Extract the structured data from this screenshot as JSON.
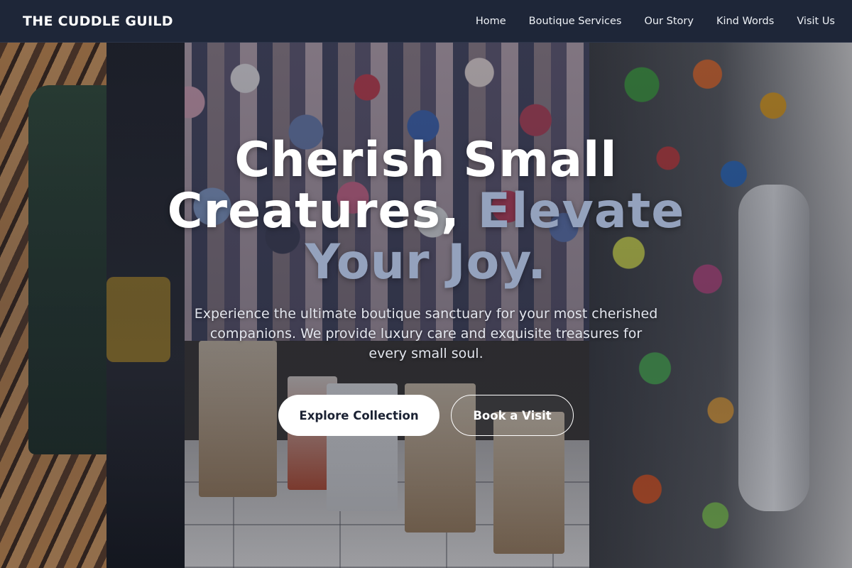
{
  "navbar": {
    "brand": "THE CUDDLE GUILD",
    "links": [
      "Home",
      "Boutique Services",
      "Our Story",
      "Kind Words",
      "Visit Us"
    ]
  },
  "hero": {
    "headline_part1": "Cherish Small Creatures, ",
    "headline_accent": "Elevate Your Joy.",
    "subtitle": "Experience the ultimate boutique sanctuary for your most cherished companions. We provide luxury care and exquisite treasures for every small soul.",
    "primary_cta": "Explore Collection",
    "secondary_cta": "Book a Visit"
  },
  "colors": {
    "navbar_bg": "#1e2638",
    "accent_text": "#94a2bd",
    "primary_button_bg": "#ffffff",
    "primary_button_text": "#1b2233"
  }
}
